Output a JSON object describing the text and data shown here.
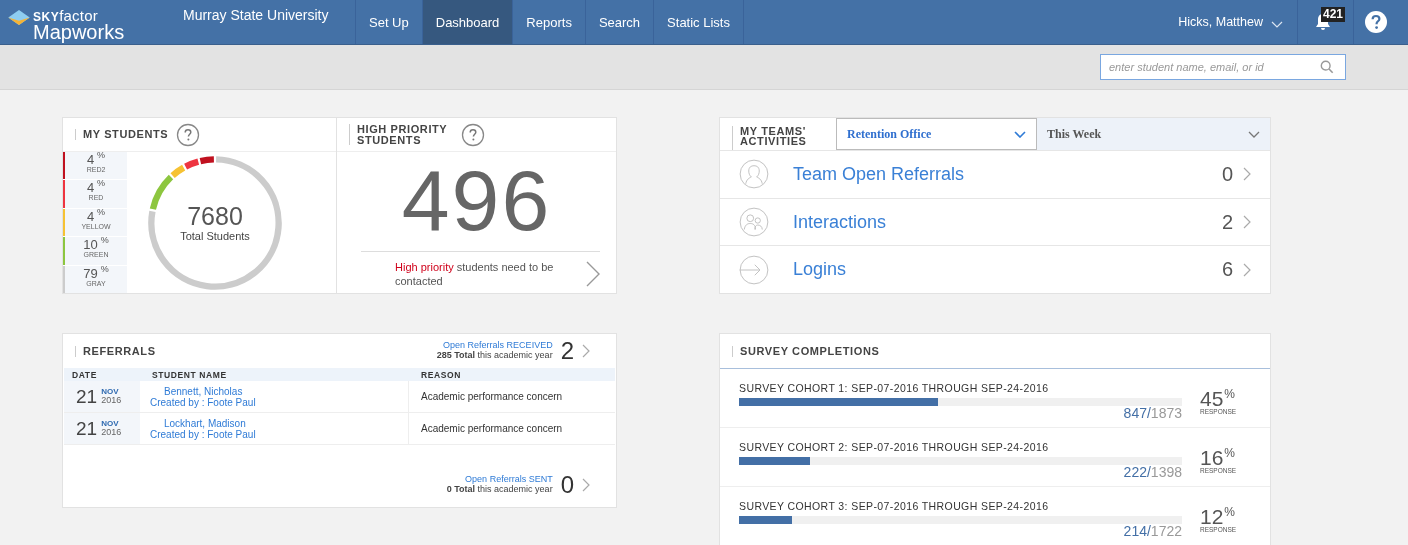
{
  "header": {
    "logo_top": "**SKY**factor",
    "logo_bottom": "Mapworks",
    "institution": "Murray State University",
    "nav": [
      {
        "label": "Set Up",
        "selected": false
      },
      {
        "label": "Dashboard",
        "selected": true
      },
      {
        "label": "Reports",
        "selected": false
      },
      {
        "label": "Search",
        "selected": false
      },
      {
        "label": "Static Lists",
        "selected": false
      }
    ],
    "user": "Hicks, Matthew",
    "notifications": "421"
  },
  "search": {
    "placeholder": "enter student name, email, or id"
  },
  "my_students": {
    "title": "MY STUDENTS",
    "total": "7680",
    "total_label": "Total Students",
    "legend": [
      {
        "value": "4",
        "unit": "%",
        "label": "RED2",
        "color": "#c0111f"
      },
      {
        "value": "4",
        "unit": "%",
        "label": "RED",
        "color": "#ee3440"
      },
      {
        "value": "4",
        "unit": "%",
        "label": "YELLOW",
        "color": "#f6c233"
      },
      {
        "value": "10",
        "unit": "%",
        "label": "GREEN",
        "color": "#8dc63f"
      },
      {
        "value": "79",
        "unit": "%",
        "label": "GRAY",
        "color": "#cccccc"
      }
    ]
  },
  "high_priority": {
    "title": "HIGH PRIORITY STUDENTS",
    "count": "496",
    "highlight": "High priority",
    "text": " students need to be contacted"
  },
  "team_activities": {
    "title": "MY TEAMS' ACTIVITIES",
    "team": "Retention Office",
    "period": "This Week",
    "items": [
      {
        "kind": "person",
        "label": "Team Open Referrals",
        "count": "0"
      },
      {
        "kind": "group",
        "label": "Interactions",
        "count": "2"
      },
      {
        "kind": "login",
        "label": "Logins",
        "count": "6"
      }
    ]
  },
  "referrals": {
    "title": "REFERRALS",
    "received": {
      "link": "Open Referrals RECEIVED",
      "total": "285 Total",
      "suffix": " this academic year",
      "count": "2"
    },
    "columns": [
      "DATE",
      "STUDENT NAME",
      "REASON"
    ],
    "rows": [
      {
        "day": "21",
        "month": "NOV",
        "year": "2016",
        "student": "Bennett, Nicholas",
        "created_by": "Created by : Foote Paul",
        "reason": "Academic performance concern"
      },
      {
        "day": "21",
        "month": "NOV",
        "year": "2016",
        "student": "Lockhart, Madison",
        "created_by": "Created by : Foote Paul",
        "reason": "Academic performance concern"
      }
    ],
    "sent": {
      "link": "Open Referrals SENT",
      "total": "0 Total",
      "suffix": " this academic year",
      "count": "0"
    }
  },
  "survey": {
    "title": "SURVEY COMPLETIONS",
    "cohorts": [
      {
        "name": "SURVEY COHORT 1: SEP-07-2016 THROUGH SEP-24-2016",
        "level": 0.45,
        "done": "847/",
        "total": "1873",
        "percent": "45",
        "unit": "%",
        "caption": "RESPONSE"
      },
      {
        "name": "SURVEY COHORT 2: SEP-07-2016 THROUGH SEP-24-2016",
        "level": 0.16,
        "done": "222/",
        "total": "1398",
        "percent": "16",
        "unit": "%",
        "caption": "RESPONSE"
      },
      {
        "name": "SURVEY COHORT 3: SEP-07-2016 THROUGH SEP-24-2016",
        "level": 0.12,
        "done": "214/",
        "total": "1722",
        "percent": "12",
        "unit": "%",
        "caption": "RESPONSE"
      }
    ]
  }
}
